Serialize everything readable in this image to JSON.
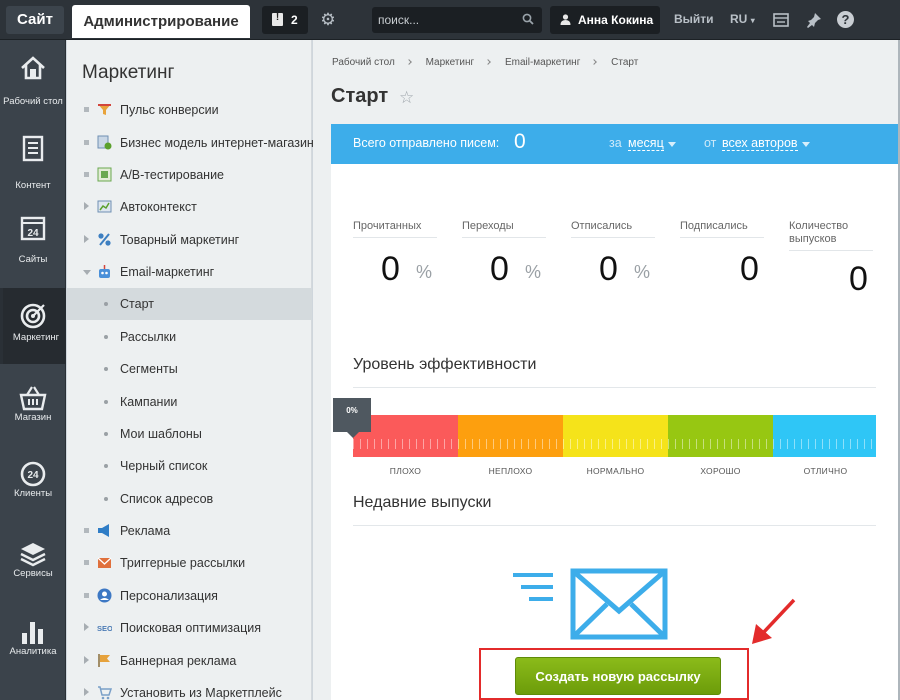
{
  "topbar": {
    "site_label": "Сайт",
    "admin_label": "Администрирование",
    "notifications_count": "2",
    "search_placeholder": "поиск...",
    "user_name": "Анна Кокина",
    "logout_label": "Выйти",
    "lang_label": "RU",
    "help_label": "?"
  },
  "rail": {
    "items": [
      {
        "label": "Рабочий стол",
        "icon": "home-icon"
      },
      {
        "label": "Контент",
        "icon": "document-icon"
      },
      {
        "label": "Сайты",
        "icon": "calendar-24-icon"
      },
      {
        "label": "Маркетинг",
        "icon": "target-icon"
      },
      {
        "label": "Магазин",
        "icon": "basket-icon"
      },
      {
        "label": "Клиенты",
        "icon": "clients-24-icon"
      },
      {
        "label": "Сервисы",
        "icon": "layers-icon"
      },
      {
        "label": "Аналитика",
        "icon": "bar-chart-icon"
      }
    ],
    "active": "Маркетинг"
  },
  "menu": {
    "title": "Маркетинг",
    "items": [
      {
        "label": "Пульс конверсии",
        "type": "leaf",
        "icon": "funnel-icon",
        "color": "#e8a33b"
      },
      {
        "label": "Бизнес модель интернет-магазина",
        "type": "leaf",
        "icon": "business-model-icon",
        "color": "#5aa02c"
      },
      {
        "label": "A/B-тестирование",
        "type": "leaf",
        "icon": "ab-test-icon",
        "color": "#6aa84f"
      },
      {
        "label": "Автоконтекст",
        "type": "folder",
        "icon": "autocontext-icon",
        "color": "#6f8fb3"
      },
      {
        "label": "Товарный маркетинг",
        "type": "folder",
        "icon": "percent-icon",
        "color": "#3d7fc1"
      },
      {
        "label": "Email-маркетинг",
        "type": "open",
        "icon": "email-robot-icon",
        "color": "#4a90d9"
      },
      {
        "label": "Старт",
        "type": "sub",
        "active": true
      },
      {
        "label": "Рассылки",
        "type": "sub"
      },
      {
        "label": "Сегменты",
        "type": "sub"
      },
      {
        "label": "Кампании",
        "type": "sub"
      },
      {
        "label": "Мои шаблоны",
        "type": "sub"
      },
      {
        "label": "Черный список",
        "type": "sub"
      },
      {
        "label": "Список адресов",
        "type": "sub"
      },
      {
        "label": "Реклама",
        "type": "leaf",
        "icon": "megaphone-icon",
        "color": "#2f7dc6"
      },
      {
        "label": "Триггерные рассылки",
        "type": "leaf",
        "icon": "trigger-mail-icon",
        "color": "#e0703c"
      },
      {
        "label": "Персонализация",
        "type": "leaf",
        "icon": "person-icon",
        "color": "#3d78c4"
      },
      {
        "label": "Поисковая оптимизация",
        "type": "folder",
        "icon": "seo-icon",
        "color": "#4b7bb5"
      },
      {
        "label": "Баннерная реклама",
        "type": "folder",
        "icon": "flag-icon",
        "color": "#e6a23c"
      },
      {
        "label": "Установить из Маркетплейс",
        "type": "folder",
        "icon": "cart-icon",
        "color": "#7aa0c8"
      }
    ]
  },
  "breadcrumbs": [
    "Рабочий стол",
    "Маркетинг",
    "Email-маркетинг",
    "Старт"
  ],
  "page_title": "Старт",
  "summary": {
    "label": "Всего отправлено писем:",
    "value": "0",
    "period_prefix": "за",
    "period_value": "месяц",
    "author_prefix": "от",
    "author_value": "всех авторов"
  },
  "stats": [
    {
      "label": "Прочитанных",
      "value": "0",
      "unit": "%"
    },
    {
      "label": "Переходы",
      "value": "0",
      "unit": "%"
    },
    {
      "label": "Отписались",
      "value": "0",
      "unit": "%"
    },
    {
      "label": "Подписались",
      "value": "0",
      "unit": ""
    },
    {
      "label": "Количество выпусков",
      "value": "0",
      "unit": ""
    }
  ],
  "efficiency": {
    "title": "Уровень эффективности",
    "indicator": "0%",
    "indicator_value": 0,
    "levels": [
      {
        "label": "ПЛОХО",
        "color": "#fb5a5a"
      },
      {
        "label": "НЕПЛОХО",
        "color": "#fd9f0e"
      },
      {
        "label": "НОРМАЛЬНО",
        "color": "#f5e31a"
      },
      {
        "label": "ХОРОШО",
        "color": "#97c712"
      },
      {
        "label": "ОТЛИЧНО",
        "color": "#2fc6f6"
      }
    ]
  },
  "recent": {
    "title": "Недавние выпуски",
    "create_button": "Создать новую рассылку"
  },
  "colors": {
    "accent_blue": "#3dadea",
    "button_green": "#7aaa10",
    "highlight_red": "#e32b2b"
  }
}
